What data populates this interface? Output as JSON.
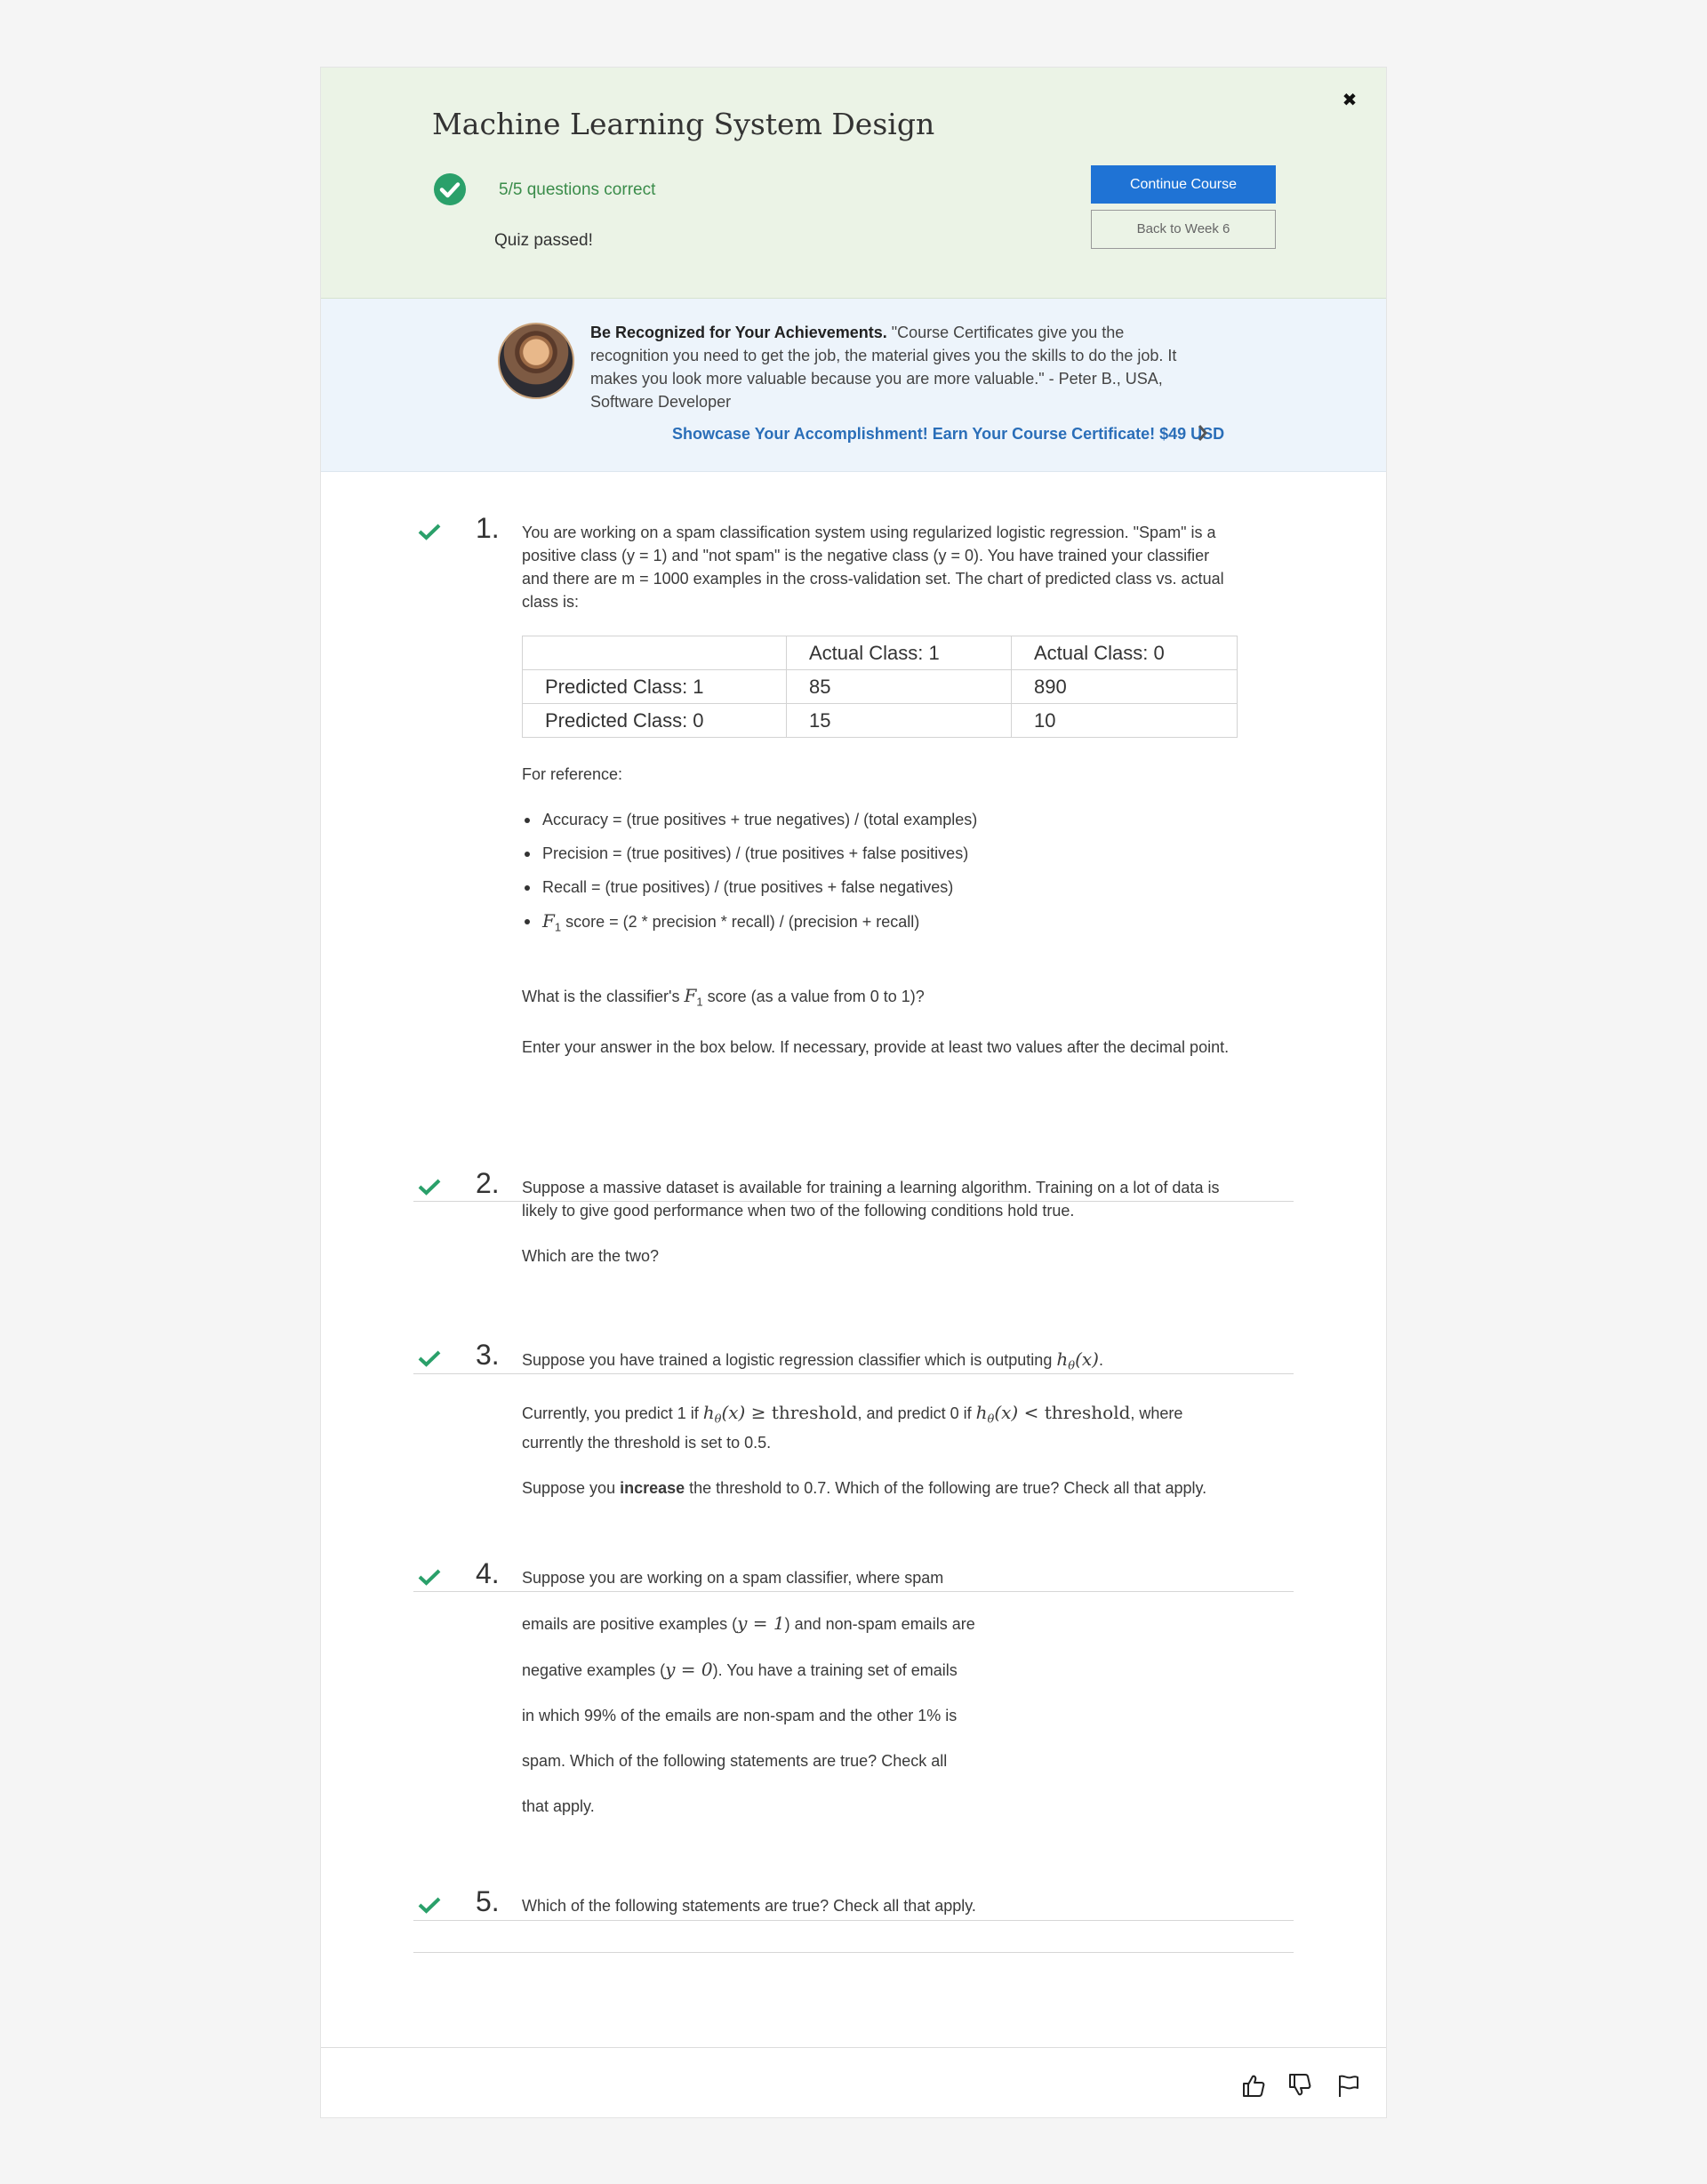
{
  "header": {
    "title": "Machine Learning System Design",
    "score": "5/5 questions correct",
    "status": "Quiz passed!",
    "continue_label": "Continue Course",
    "back_label": "Back to Week 6",
    "close_symbol": "✖"
  },
  "promo": {
    "heading": "Be Recognized for Your Achievements.",
    "quote": " \"Course Certificates give you the recognition you need to get the job, the material gives you the skills to do the job. It makes you look more valuable because you are more valuable.\" - Peter B., USA, Software Developer",
    "link": "Showcase Your Accomplishment! Earn Your Course Certificate! $49 USD"
  },
  "questions": [
    {
      "number": "1.",
      "intro": "You are working on a spam classification system using regularized logistic regression. \"Spam\" is a positive class (y = 1) and \"not spam\" is the negative class (y = 0). You have trained your classifier and there are m = 1000 examples in the cross-validation set. The chart of predicted class vs. actual class is:",
      "table": {
        "headers": [
          "",
          "Actual Class: 1",
          "Actual Class: 0"
        ],
        "rows": [
          [
            "Predicted Class: 1",
            "85",
            "890"
          ],
          [
            "Predicted Class: 0",
            "15",
            "10"
          ]
        ]
      },
      "reference_label": "For reference:",
      "reference": [
        "Accuracy = (true positives + true negatives) / (total examples)",
        "Precision = (true positives) / (true positives + false positives)",
        "Recall = (true positives) / (true positives + false negatives)",
        " score = (2 * precision * recall) / (precision + recall)"
      ],
      "f1_symbol": "F",
      "f1_sub": "1",
      "ask_before": "What is the classifier's ",
      "ask_after": " score (as a value from 0 to 1)?",
      "instruction": "Enter your answer in the box below. If necessary, provide at least two values after the decimal point."
    },
    {
      "number": "2.",
      "p1": "Suppose a massive dataset is available for training a learning algorithm. Training on a lot of data is likely to give good performance when two of the following conditions hold true.",
      "p2": "Which are the two?"
    },
    {
      "number": "3.",
      "p1a": "Suppose you have trained a logistic regression classifier which is outputing ",
      "p1_math": "h",
      "p1_sub": "θ",
      "p1_arg": "(x)",
      "p1b": ".",
      "p2a": "Currently, you predict 1 if ",
      "p2_ge": " ≥ threshold",
      "p2b": ", and predict 0 if ",
      "p2_lt": " < threshold",
      "p2c": ", where currently the threshold is set to 0.5.",
      "p3a": "Suppose you ",
      "p3_bold": "increase",
      "p3b": " the threshold to 0.7. Which of the following are true? Check all that apply."
    },
    {
      "number": "4.",
      "l1": "Suppose you are working on a spam classifier, where spam",
      "l2a": "emails are positive examples (",
      "l2_math": "y = 1",
      "l2b": ") and non-spam emails are",
      "l3a": "negative examples (",
      "l3_math": "y = 0",
      "l3b": "). You have a training set of emails",
      "l4": "in which 99% of the emails are non-spam and the other 1% is",
      "l5": "spam. Which of the following statements are true? Check all",
      "l6": "that apply."
    },
    {
      "number": "5.",
      "p1": "Which of the following statements are true? Check all that apply."
    }
  ],
  "colors": {
    "header_bg": "#ebf3e6",
    "promo_bg": "#edf4fb",
    "accent_blue": "#1f73d5",
    "success_green": "#2aa06a"
  },
  "footer": {
    "icons": [
      "thumbs-up-icon",
      "thumbs-down-icon",
      "flag-icon"
    ]
  }
}
